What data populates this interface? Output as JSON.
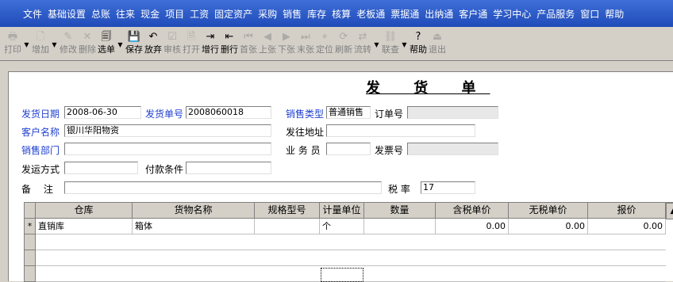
{
  "menu": [
    "文件",
    "基础设置",
    "总账",
    "往来",
    "现金",
    "项目",
    "工资",
    "固定资产",
    "采购",
    "销售",
    "库存",
    "核算",
    "老板通",
    "票据通",
    "出纳通",
    "客户通",
    "学习中心",
    "产品服务",
    "窗口",
    "帮助"
  ],
  "toolbar": {
    "print": "打印",
    "add": "增加",
    "modify": "修改",
    "delete": "删除",
    "select": "选单",
    "save": "保存",
    "abandon": "放弃",
    "audit": "审核",
    "open": "打开",
    "add_row": "增行",
    "delete_row": "删行",
    "first": "首张",
    "prev": "上张",
    "next": "下张",
    "last": "末张",
    "locate": "定位",
    "refresh": "刷新",
    "flow": "流转",
    "link": "联查",
    "help": "帮助",
    "exit": "退出"
  },
  "form": {
    "title": "发 货 单",
    "ship_date_label": "发货日期",
    "ship_date": "2008-06-30",
    "ship_no_label": "发货单号",
    "ship_no": "2008060018",
    "sale_type_label": "销售类型",
    "sale_type": "普通销售",
    "order_no_label": "订单号",
    "order_no": "",
    "customer_label": "客户名称",
    "customer": "银川华阳物资",
    "ship_addr_label": "发往地址",
    "ship_addr": "",
    "dept_label": "销售部门",
    "dept": "",
    "salesman_label": "业 务 员",
    "salesman": "",
    "invoice_no_label": "发票号",
    "invoice_no": "",
    "ship_method_label": "发运方式",
    "ship_method": "",
    "payment_label": "付款条件",
    "payment": "",
    "remark_label": "备　 注",
    "remark": "",
    "tax_label": "税  率",
    "tax_rate": "17"
  },
  "grid": {
    "headers": [
      "仓库",
      "货物名称",
      "规格型号",
      "计量单位",
      "数量",
      "含税单价",
      "无税单价",
      "报价"
    ],
    "rows": [
      {
        "marker": "*",
        "warehouse": "直销库",
        "name": "箱体",
        "spec": "",
        "unit": "个",
        "qty": "",
        "price_tax": "0.00",
        "price_notax": "0.00",
        "quote": "0.00"
      }
    ]
  }
}
